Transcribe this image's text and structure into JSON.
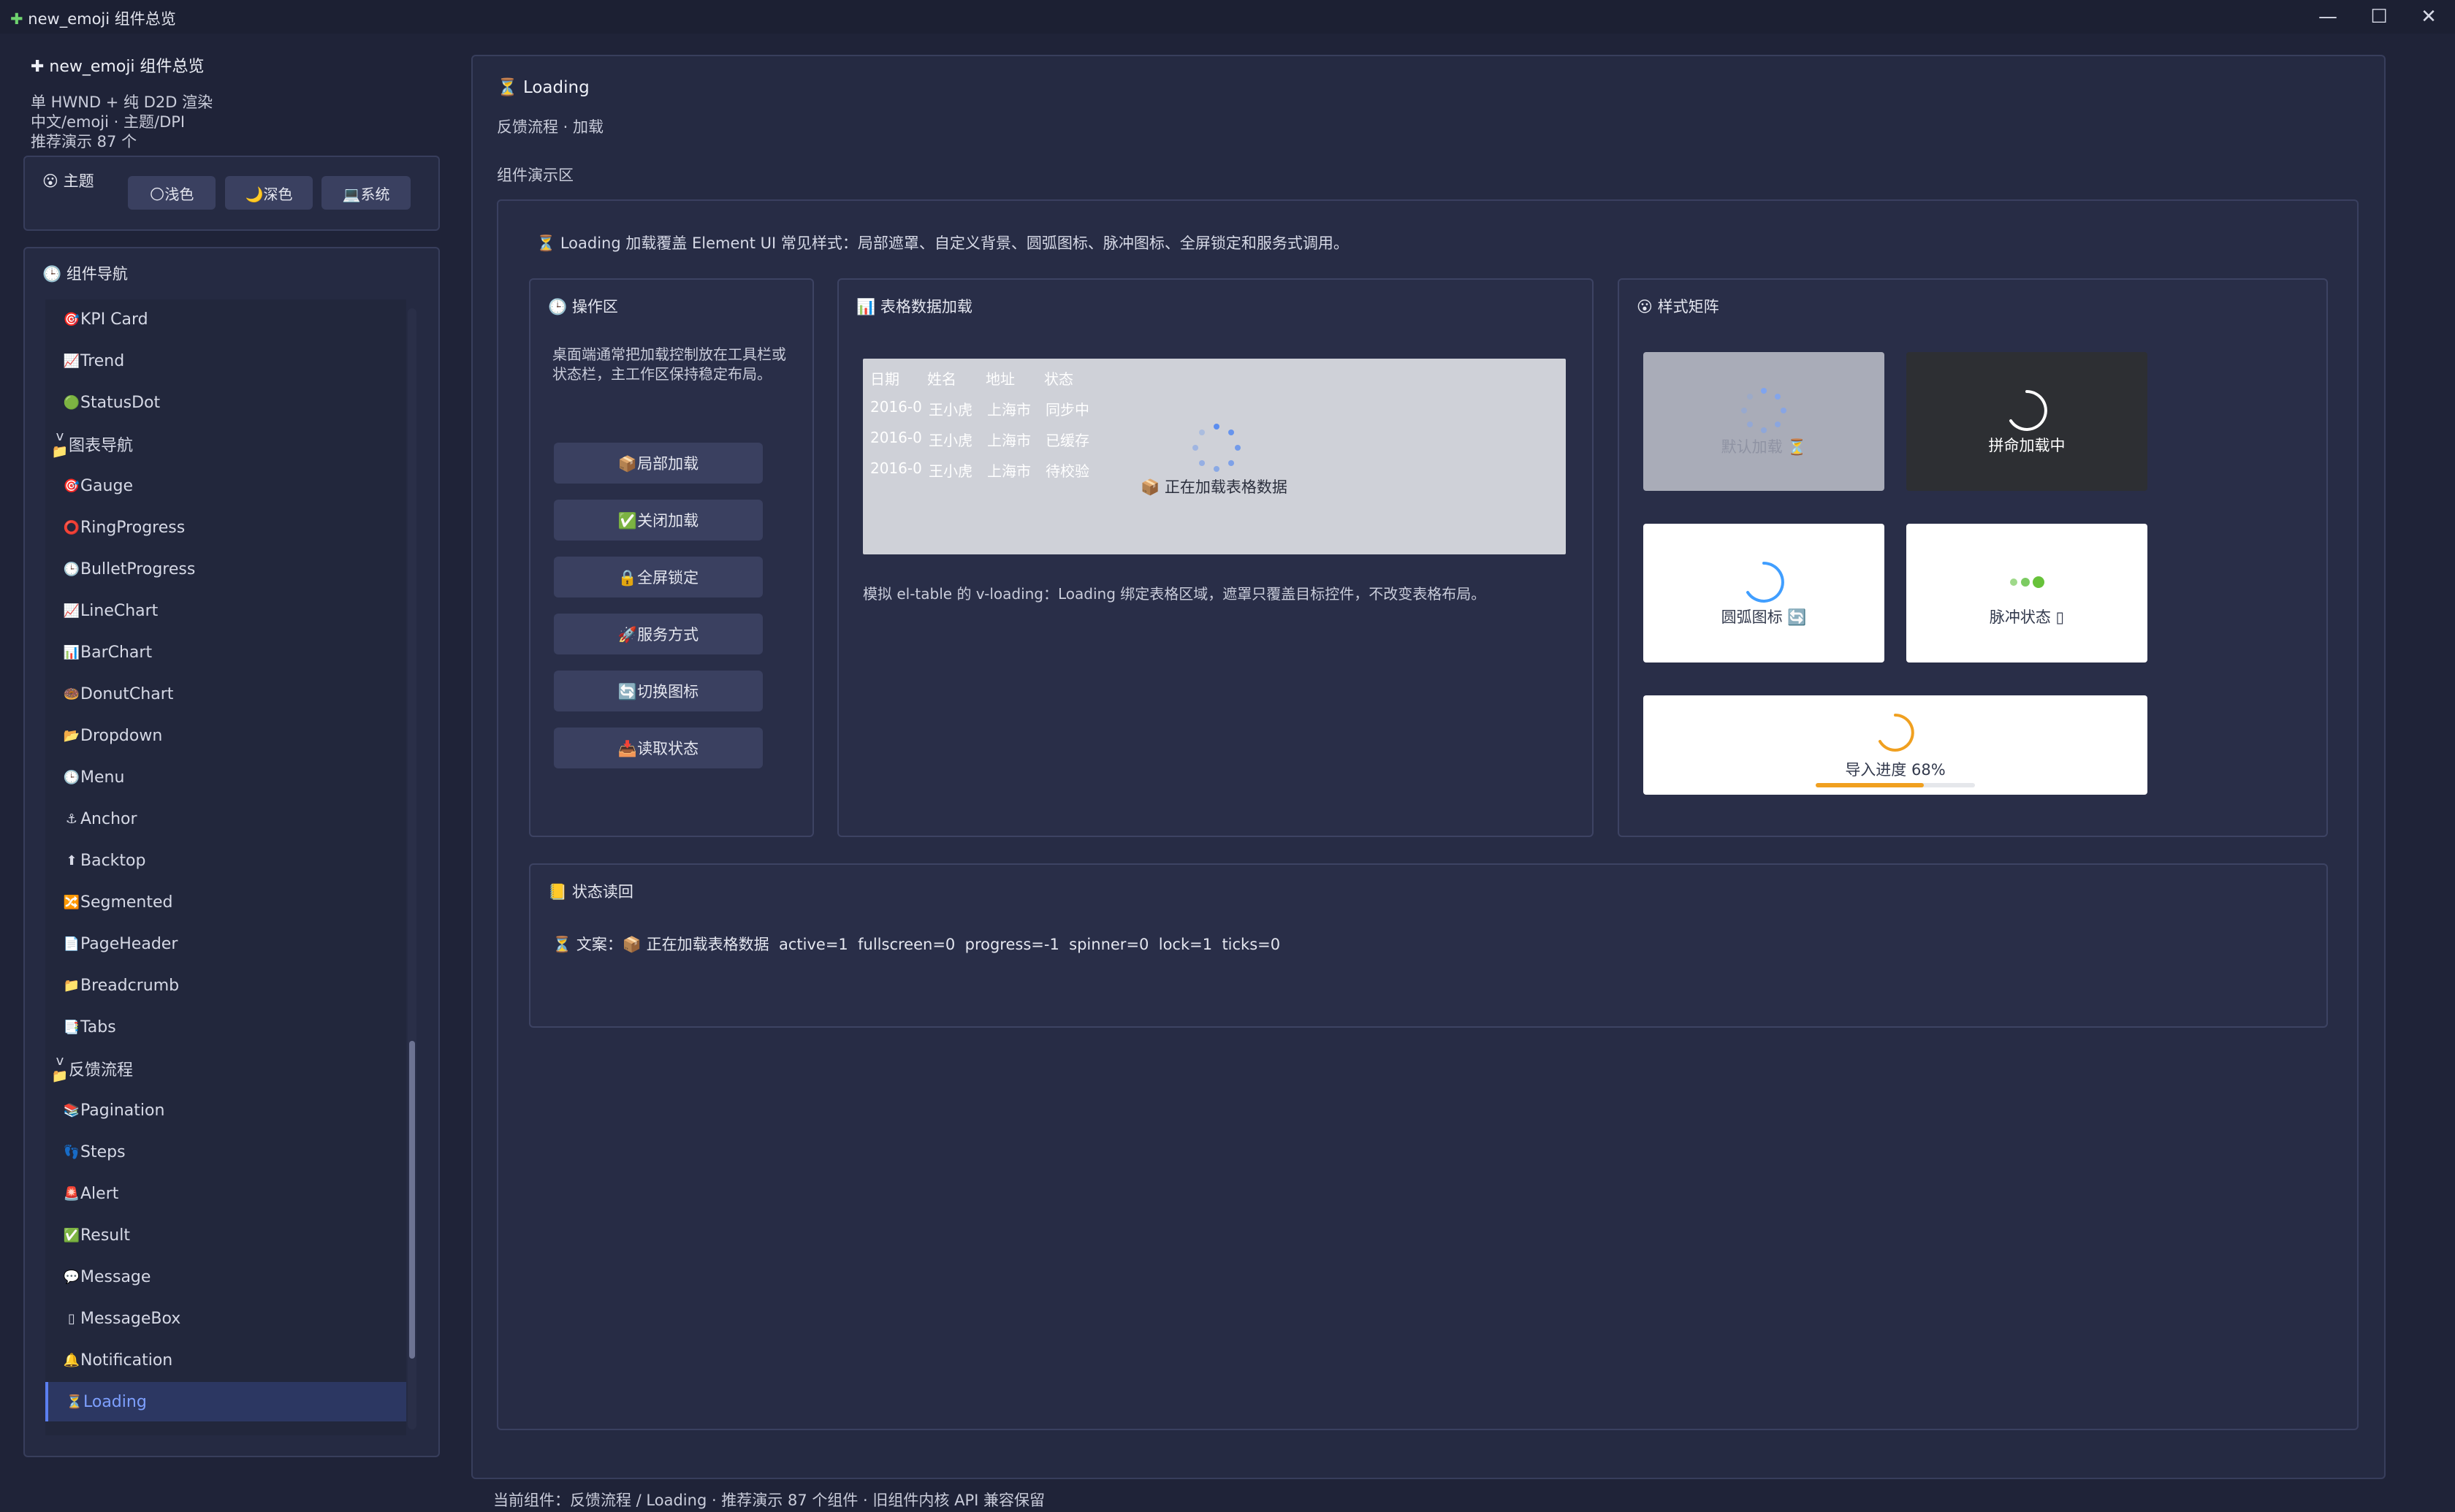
{
  "window": {
    "title": "new_emoji 组件总览",
    "app_icon": "✚",
    "controls": [
      "—",
      "☐",
      "✕"
    ]
  },
  "sidebar": {
    "app_title": "✚ new_emoji 组件总览",
    "lines": [
      "单 HWND + 纯 D2D 渲染",
      "中文/emoji · 主题/DPI",
      "推荐演示 87 个"
    ],
    "theme": {
      "label": "😮 主题",
      "buttons": [
        "🌕浅色",
        "🌙深色",
        "💻系统"
      ]
    },
    "nav": {
      "title": "🕒 组件导航",
      "items": [
        {
          "icon": "🎯",
          "label": "KPI Card"
        },
        {
          "icon": "📈",
          "label": "Trend"
        },
        {
          "icon": "🟢",
          "label": "StatusDot"
        },
        {
          "icon": "v 📁",
          "label": "图表导航",
          "group": true
        },
        {
          "icon": "🎯",
          "label": "Gauge"
        },
        {
          "icon": "⭕",
          "label": "RingProgress"
        },
        {
          "icon": "🕒",
          "label": "BulletProgress"
        },
        {
          "icon": "📈",
          "label": "LineChart"
        },
        {
          "icon": "📊",
          "label": "BarChart"
        },
        {
          "icon": "🍩",
          "label": "DonutChart"
        },
        {
          "icon": "📂",
          "label": "Dropdown"
        },
        {
          "icon": "🕒",
          "label": "Menu"
        },
        {
          "icon": "⚓",
          "label": "Anchor"
        },
        {
          "icon": "⬆",
          "label": "Backtop"
        },
        {
          "icon": "🔀",
          "label": "Segmented"
        },
        {
          "icon": "📄",
          "label": "PageHeader"
        },
        {
          "icon": "📁",
          "label": "Breadcrumb"
        },
        {
          "icon": "📑",
          "label": "Tabs"
        },
        {
          "icon": "v 📁",
          "label": "反馈流程",
          "group": true
        },
        {
          "icon": "📚",
          "label": "Pagination"
        },
        {
          "icon": "👣",
          "label": "Steps"
        },
        {
          "icon": "🚨",
          "label": "Alert"
        },
        {
          "icon": "✅",
          "label": "Result"
        },
        {
          "icon": "💬",
          "label": "Message"
        },
        {
          "icon": "▯",
          "label": "MessageBox"
        },
        {
          "icon": "🔔",
          "label": "Notification"
        },
        {
          "icon": "⏳",
          "label": "Loading",
          "active": true
        }
      ]
    }
  },
  "main": {
    "title": "⏳ Loading",
    "subtitle": "反馈流程 · 加载",
    "demo_label": "组件演示区",
    "description": "⏳ Loading 加载覆盖 Element UI 常见样式：局部遮罩、自定义背景、圆弧图标、脉冲图标、全屏锁定和服务式调用。",
    "ops": {
      "title": "🕒 操作区",
      "hint": "桌面端通常把加载控制放在工具栏或状态栏，主工作区保持稳定布局。",
      "buttons": [
        "📦局部加载",
        "✅关闭加载",
        "🔒全屏锁定",
        "🚀服务方式",
        "🔄切换图标",
        "📥读取状态"
      ]
    },
    "table_card": {
      "title": "📊 表格数据加载",
      "headers": [
        "日期",
        "姓名",
        "地址",
        "状态"
      ],
      "rows": [
        [
          "2016-0",
          "王小虎",
          "上海市",
          "同步中"
        ],
        [
          "2016-0",
          "王小虎",
          "上海市",
          "已缓存"
        ],
        [
          "2016-0",
          "王小虎",
          "上海市",
          "待校验"
        ]
      ],
      "overlay_text": "📦 正在加载表格数据",
      "note": "模拟 el-table 的 v-loading：Loading 绑定表格区域，遮罩只覆盖目标控件，不改变表格布局。"
    },
    "matrix": {
      "title": "😮 样式矩阵",
      "tiles": [
        {
          "label": "默认加载 ⏳"
        },
        {
          "label": "拼命加载中"
        },
        {
          "label": "圆弧图标 🔄"
        },
        {
          "label": "脉冲状态 ▯"
        }
      ],
      "progress_label": "导入进度 68%",
      "progress_value": 0.68
    },
    "status": {
      "title": "📒 状态读回",
      "line": "⏳ 文案：📦 正在加载表格数据  active=1  fullscreen=0  progress=-1  spinner=0  lock=1  ticks=0"
    }
  },
  "statusbar": "当前组件：反馈流程 / Loading · 推荐演示 87 个组件 · 旧组件内核 API 兼容保留",
  "colors": {
    "bg": "#1f2338",
    "panel": "#252a42",
    "accent": "#5b7ff0",
    "progress": "#f0a020",
    "pulse": "#67c23a"
  }
}
